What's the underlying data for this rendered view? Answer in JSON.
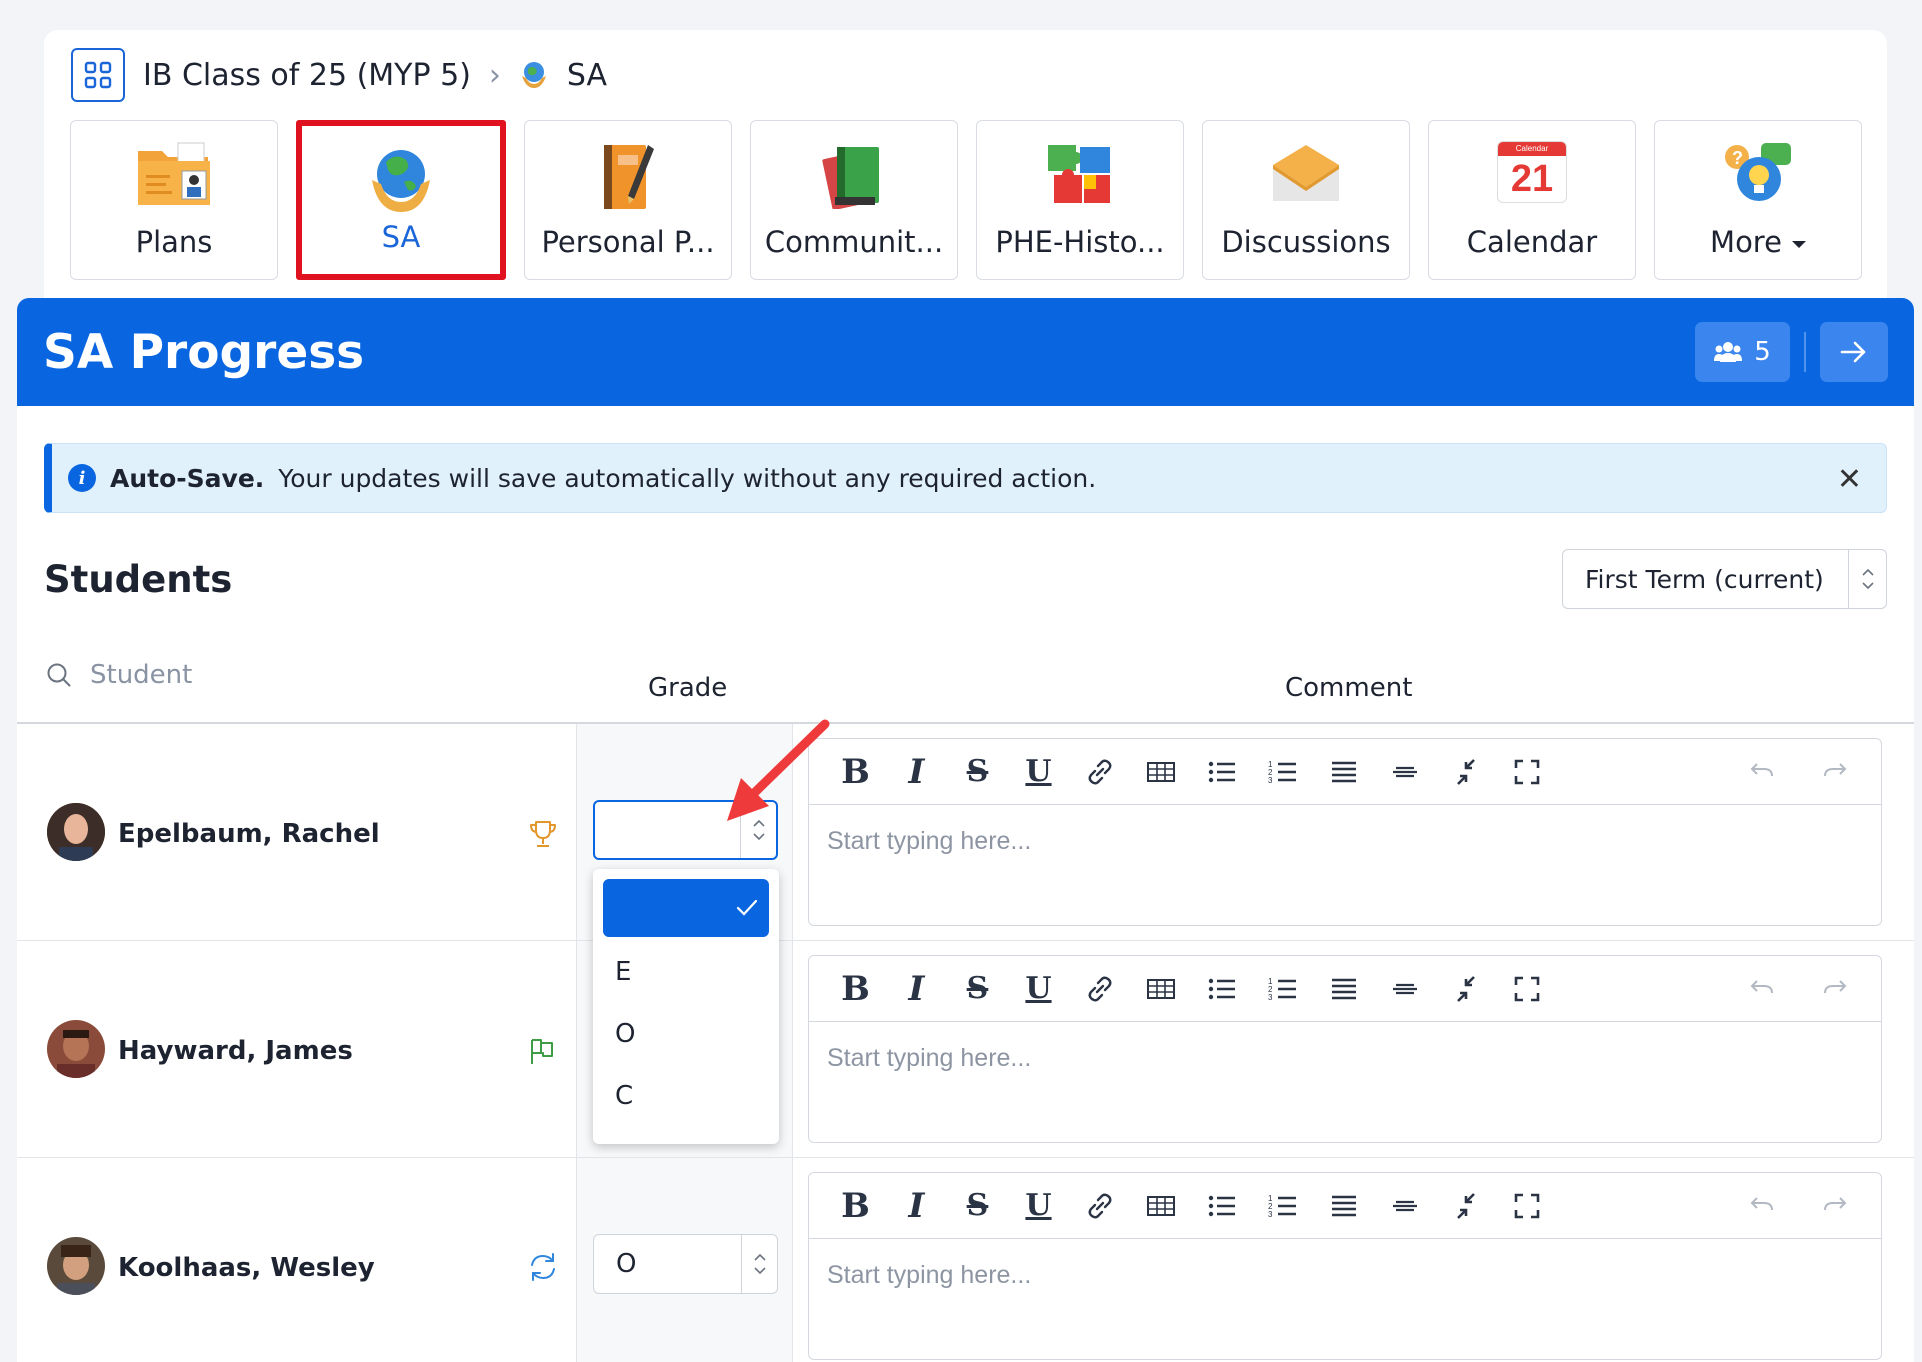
{
  "breadcrumb": {
    "course": "IB Class of 25 (MYP 5)",
    "current": "SA"
  },
  "tiles": [
    {
      "label": "Plans",
      "icon": "folder-icon"
    },
    {
      "label": "SA",
      "icon": "globe-hands-icon",
      "active": true
    },
    {
      "label": "Personal P...",
      "icon": "notebook-icon"
    },
    {
      "label": "Communit...",
      "icon": "books-icon"
    },
    {
      "label": "PHE-Histo...",
      "icon": "puzzle-icon"
    },
    {
      "label": "Discussions",
      "icon": "envelope-icon"
    },
    {
      "label": "Calendar",
      "icon": "calendar-icon",
      "calendar_day": "21",
      "calendar_header": "Calendar"
    },
    {
      "label": "More",
      "icon": "chat-lightbulb-icon"
    }
  ],
  "panel": {
    "title": "SA Progress",
    "members_count": "5"
  },
  "alert": {
    "title": "Auto-Save.",
    "message": "Your updates will save automatically without any required action."
  },
  "students_section": {
    "title": "Students",
    "term": "First Term (current)",
    "search_placeholder": "Student",
    "col_grade": "Grade",
    "col_comment": "Comment"
  },
  "rows": [
    {
      "name": "Epelbaum, Rachel",
      "status_icon": "trophy-icon",
      "grade": "",
      "comment_placeholder": "Start typing here..."
    },
    {
      "name": "Hayward, James",
      "status_icon": "flag-icon",
      "grade": "",
      "comment_placeholder": "Start typing here..."
    },
    {
      "name": "Koolhaas, Wesley",
      "status_icon": "refresh-icon",
      "grade": "O",
      "comment_placeholder": "Start typing here..."
    }
  ],
  "grade_dropdown": {
    "options": [
      "",
      "E",
      "O",
      "C"
    ],
    "selected_index": 0
  },
  "colors": {
    "brand_blue": "#0a66e0",
    "highlight_red": "#e0121f",
    "annotation_arrow": "#ee3a3a"
  }
}
